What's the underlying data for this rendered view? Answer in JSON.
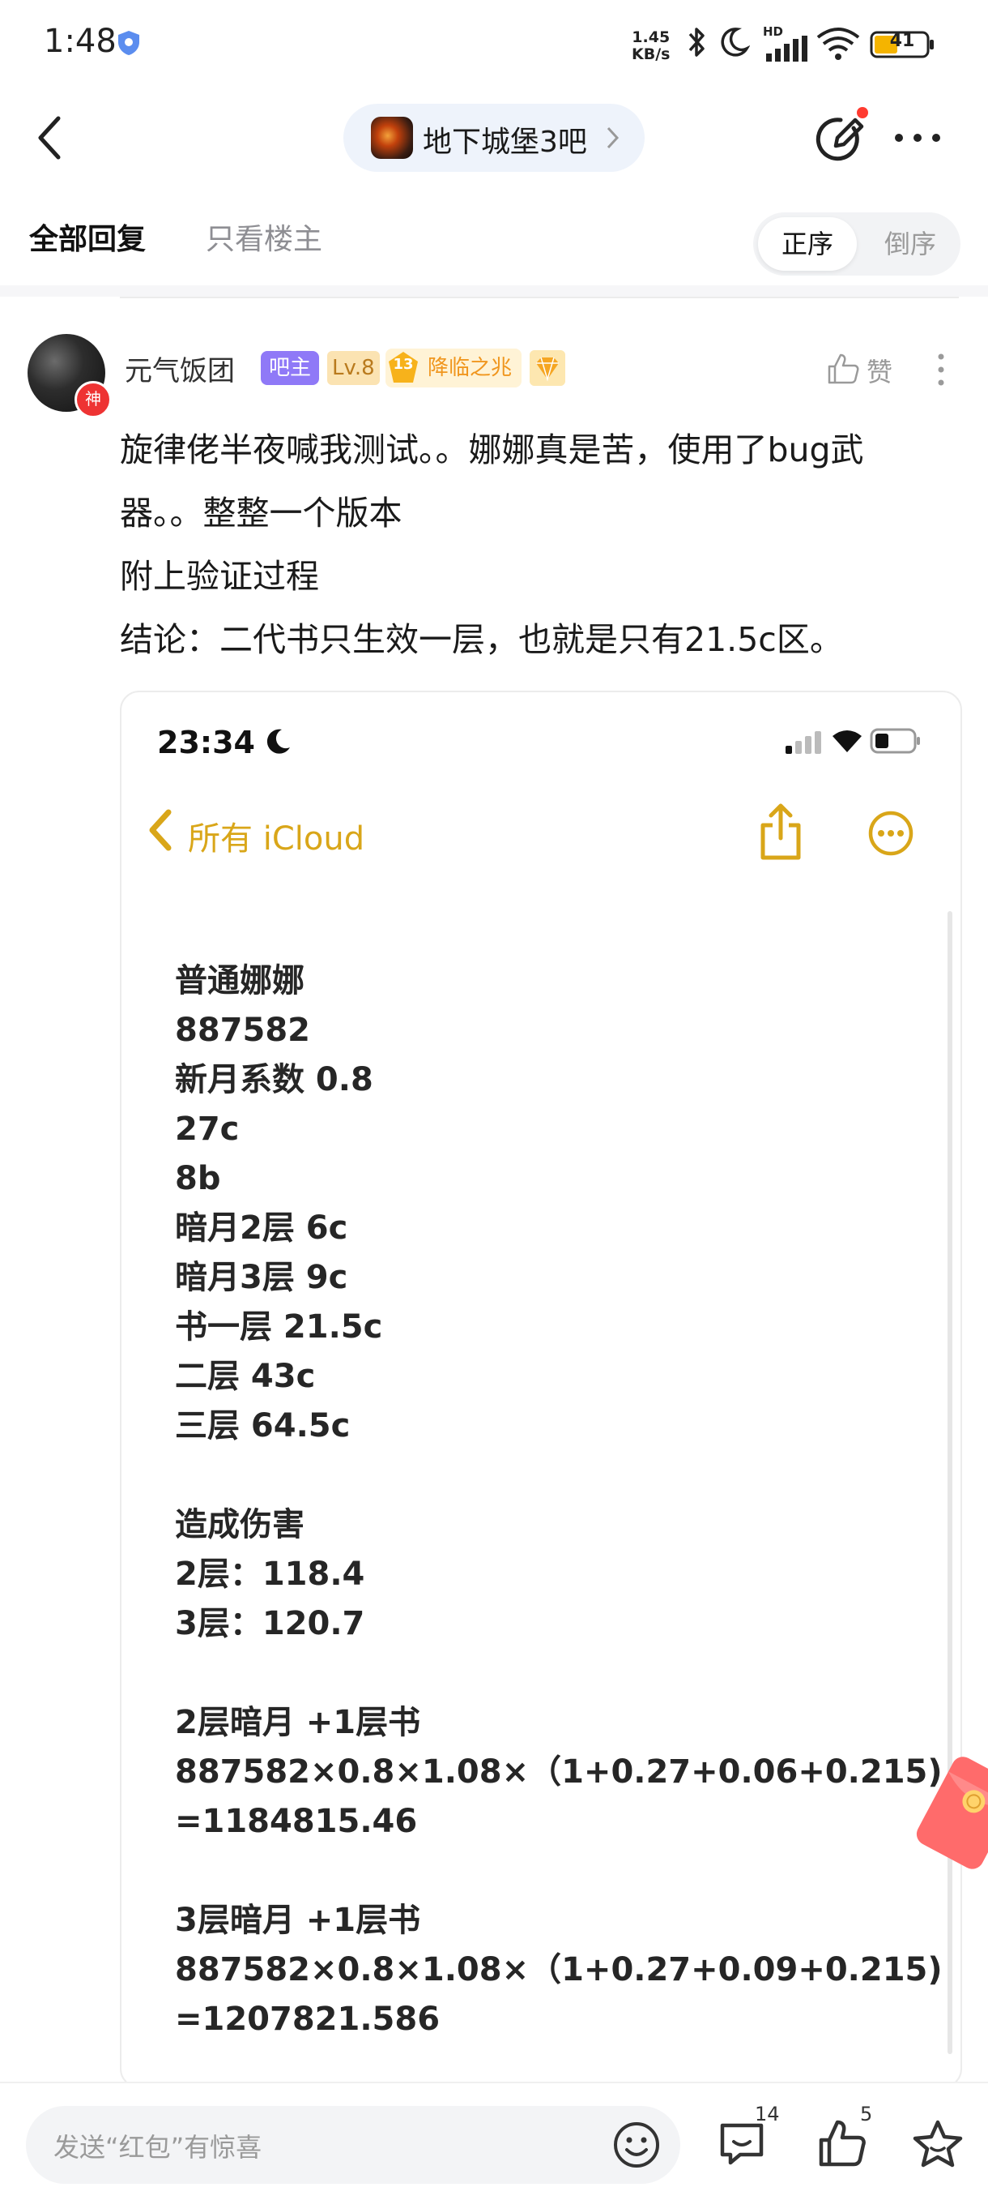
{
  "status_bar": {
    "time": "1:48",
    "net_speed_value": "1.45",
    "net_speed_unit": "KB/s",
    "network_label": "HD",
    "battery_level": "41"
  },
  "header": {
    "forum_name": "地下城堡3吧"
  },
  "tabs": {
    "all_replies": "全部回复",
    "op_only": "只看楼主",
    "sort_asc": "正序",
    "sort_desc": "倒序"
  },
  "post": {
    "username": "元气饭团",
    "avatar_badge": "神",
    "role_badge": "吧主",
    "level_badge": "Lv.8",
    "medal_number": "13",
    "medal_title": "降临之兆",
    "like_label": "赞",
    "body_lines": [
      "旋律佬半夜喊我测试。。娜娜真是苦，使用了bug武",
      "器。。整整一个版本",
      "附上验证过程",
      "结论：二代书只生效一层，也就是只有21.5c区。"
    ]
  },
  "embedded_screenshot": {
    "time": "23:34",
    "folder_label": "所有 iCloud",
    "note_lines": [
      "普通娜娜",
      "887582",
      "新月系数 0.8",
      "27c",
      "8b",
      "暗月2层 6c",
      "暗月3层 9c",
      "书一层 21.5c",
      "二层 43c",
      "三层 64.5c",
      "",
      "造成伤害",
      "2层：118.4",
      "3层：120.7",
      "",
      "2层暗月 +1层书",
      "887582×0.8×1.08×（1+0.27+0.06+0.215)",
      "=1184815.46",
      "",
      "3层暗月 +1层书",
      "887582×0.8×1.08×（1+0.27+0.09+0.215)",
      "=1207821.586"
    ]
  },
  "bottom_bar": {
    "comment_placeholder": "发送“红包”有惊喜",
    "comment_count": "14",
    "like_count": "5"
  },
  "icons": {
    "back": "chevron-left-icon",
    "compose": "edit-icon",
    "more": "more-horizontal-icon",
    "like": "thumbs-up-icon",
    "emoji": "smiley-icon",
    "comments": "comment-bubble-icon",
    "favorite": "star-icon",
    "share": "share-icon"
  },
  "colors": {
    "accent_admin": "#8f79f7",
    "medal_orange": "#f0961e",
    "icloud_yellow": "#d9a619",
    "notify_red": "#ff3b30"
  }
}
